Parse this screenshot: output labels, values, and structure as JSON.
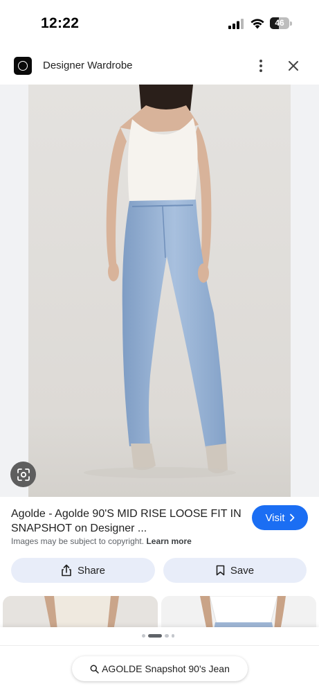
{
  "status_bar": {
    "time": "12:22",
    "battery": "46",
    "battery_level": 0.46
  },
  "header": {
    "site_name": "Designer Wardrobe"
  },
  "product": {
    "title": "Agolde - Agolde 90'S MID RISE LOOSE FIT IN SNAPSHOT on Designer ...",
    "visit_label": "Visit",
    "copyright_text": "Images may be subject to copyright.",
    "learn_more": "Learn more"
  },
  "actions": {
    "share_label": "Share",
    "save_label": "Save"
  },
  "search_chip": {
    "query": "AGOLDE Snapshot 90's Jean"
  },
  "colors": {
    "accent": "#1b6ef3",
    "chip_bg": "#e8edf9",
    "image_bg": "#f1f2f4"
  },
  "icons": [
    "signal-icon",
    "wifi-icon",
    "battery-icon",
    "more-vert-icon",
    "close-icon",
    "lens-icon",
    "share-icon",
    "bookmark-icon",
    "search-icon",
    "chevron-right-icon"
  ]
}
